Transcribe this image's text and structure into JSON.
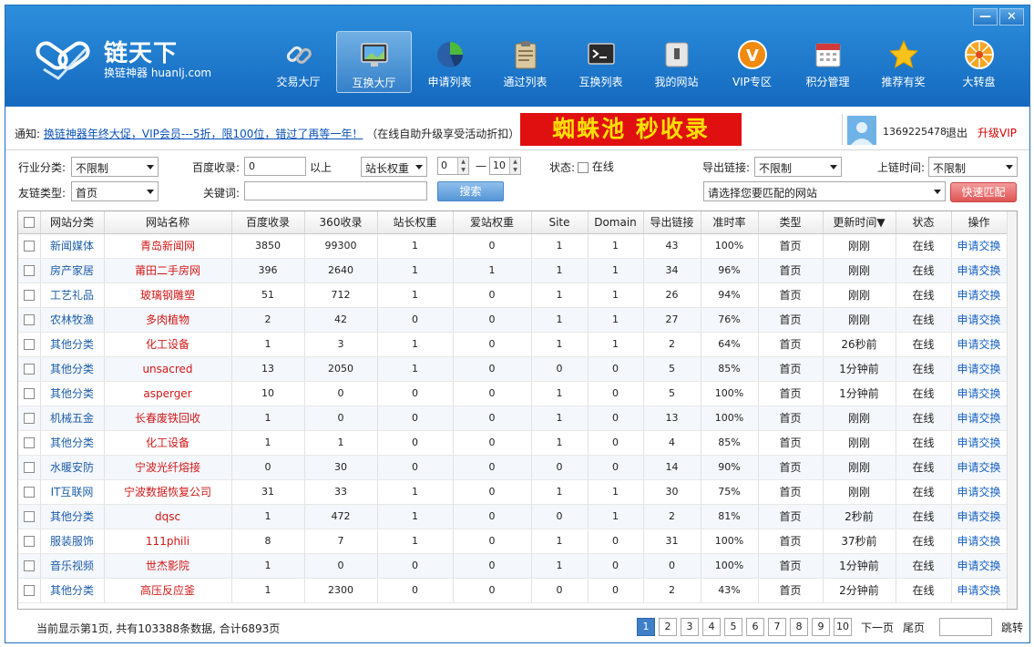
{
  "window": {
    "minimize_label": "—",
    "close_label": "✕"
  },
  "logo": {
    "title": "链天下",
    "subtitle": "换链神器 huanlj.com"
  },
  "nav": [
    {
      "label": "交易大厅",
      "icon": "link-icon"
    },
    {
      "label": "互换大厅",
      "icon": "monitor-icon",
      "active": true
    },
    {
      "label": "申请列表",
      "icon": "pie-chart-icon"
    },
    {
      "label": "通过列表",
      "icon": "clipboard-icon"
    },
    {
      "label": "互换列表",
      "icon": "terminal-icon"
    },
    {
      "label": "我的网站",
      "icon": "device-icon"
    },
    {
      "label": "VIP专区",
      "icon": "vip-icon"
    },
    {
      "label": "积分管理",
      "icon": "calendar-icon"
    },
    {
      "label": "推荐有奖",
      "icon": "star-icon"
    },
    {
      "label": "大转盘",
      "icon": "wheel-icon"
    }
  ],
  "notice": {
    "prefix": "通知:",
    "link": "换链神器年终大促，VIP会员---5折，限100位，错过了再等一年！",
    "suffix": "（在线自助升级享受活动折扣）",
    "banner": "蜘蛛池 秒收录"
  },
  "user": {
    "id": "1369225478",
    "logout": "退出",
    "upgrade": "升级VIP"
  },
  "filters": {
    "industry_label": "行业分类:",
    "industry_value": "不限制",
    "baidu_label": "百度收录:",
    "baidu_value": "0",
    "baidu_suffix": "以上",
    "weight_select": "站长权重",
    "weight_min": "0",
    "weight_dash": "—",
    "weight_max": "10",
    "status_label": "状态:",
    "status_option": "在线",
    "export_label": "导出链接:",
    "export_value": "不限制",
    "uptime_label": "上链时间:",
    "uptime_value": "不限制",
    "link_type_label": "友链类型:",
    "link_type_value": "首页",
    "keyword_label": "关键词:",
    "keyword_value": "",
    "search_button": "搜索",
    "site_select": "请选择您要匹配的网站",
    "match_button": "快速匹配"
  },
  "table": {
    "columns": [
      "网站分类",
      "网站名称",
      "百度收录",
      "360收录",
      "站长权重",
      "爱站权重",
      "Site",
      "Domain",
      "导出链接",
      "准时率",
      "类型",
      "更新时间▼",
      "状态",
      "操作"
    ],
    "rows": [
      [
        "新闻媒体",
        "青岛新闻网",
        "3850",
        "99300",
        "1",
        "0",
        "1",
        "1",
        "43",
        "100%",
        "首页",
        "刚刚",
        "在线",
        "申请交换"
      ],
      [
        "房产家居",
        "莆田二手房网",
        "396",
        "2640",
        "1",
        "1",
        "1",
        "1",
        "34",
        "96%",
        "首页",
        "刚刚",
        "在线",
        "申请交换"
      ],
      [
        "工艺礼品",
        "玻璃钢雕塑",
        "51",
        "712",
        "1",
        "0",
        "1",
        "1",
        "26",
        "94%",
        "首页",
        "刚刚",
        "在线",
        "申请交换"
      ],
      [
        "农林牧渔",
        "多肉植物",
        "2",
        "42",
        "0",
        "0",
        "1",
        "1",
        "27",
        "76%",
        "首页",
        "刚刚",
        "在线",
        "申请交换"
      ],
      [
        "其他分类",
        "化工设备",
        "1",
        "3",
        "1",
        "0",
        "1",
        "1",
        "2",
        "64%",
        "首页",
        "26秒前",
        "在线",
        "申请交换"
      ],
      [
        "其他分类",
        "unsacred",
        "13",
        "2050",
        "1",
        "0",
        "0",
        "0",
        "5",
        "85%",
        "首页",
        "1分钟前",
        "在线",
        "申请交换"
      ],
      [
        "其他分类",
        "asperger",
        "10",
        "0",
        "0",
        "0",
        "1",
        "0",
        "5",
        "100%",
        "首页",
        "1分钟前",
        "在线",
        "申请交换"
      ],
      [
        "机械五金",
        "长春废铁回收",
        "1",
        "0",
        "0",
        "0",
        "1",
        "0",
        "13",
        "100%",
        "首页",
        "刚刚",
        "在线",
        "申请交换"
      ],
      [
        "其他分类",
        "化工设备",
        "1",
        "1",
        "0",
        "0",
        "1",
        "0",
        "4",
        "85%",
        "首页",
        "刚刚",
        "在线",
        "申请交换"
      ],
      [
        "水暖安防",
        "宁波光纤熔接",
        "0",
        "30",
        "0",
        "0",
        "0",
        "0",
        "14",
        "90%",
        "首页",
        "刚刚",
        "在线",
        "申请交换"
      ],
      [
        "IT互联网",
        "宁波数据恢复公司",
        "31",
        "33",
        "1",
        "0",
        "1",
        "1",
        "30",
        "75%",
        "首页",
        "刚刚",
        "在线",
        "申请交换"
      ],
      [
        "其他分类",
        "dqsc",
        "1",
        "472",
        "1",
        "0",
        "0",
        "1",
        "2",
        "81%",
        "首页",
        "2秒前",
        "在线",
        "申请交换"
      ],
      [
        "服装服饰",
        "111phili",
        "8",
        "7",
        "1",
        "0",
        "1",
        "0",
        "31",
        "100%",
        "首页",
        "37秒前",
        "在线",
        "申请交换"
      ],
      [
        "音乐视频",
        "世杰影院",
        "1",
        "0",
        "0",
        "0",
        "1",
        "0",
        "0",
        "100%",
        "首页",
        "1分钟前",
        "在线",
        "申请交换"
      ],
      [
        "其他分类",
        "高压反应釜",
        "1",
        "2300",
        "0",
        "0",
        "0",
        "0",
        "2",
        "43%",
        "首页",
        "2分钟前",
        "在线",
        "申请交换"
      ]
    ]
  },
  "footer": {
    "info": "当前显示第1页, 共有103388条数据, 合计6893页",
    "pages": [
      "1",
      "2",
      "3",
      "4",
      "5",
      "6",
      "7",
      "8",
      "9",
      "10"
    ],
    "next": "下一页",
    "last": "尾页",
    "jump": "跳转"
  },
  "colors": {
    "header_blue": "#1a7ad0",
    "banner_red": "#e01010",
    "banner_text": "#ffe000",
    "link_blue": "#1560c4",
    "name_red": "#d21818",
    "match_red": "#e05555"
  }
}
